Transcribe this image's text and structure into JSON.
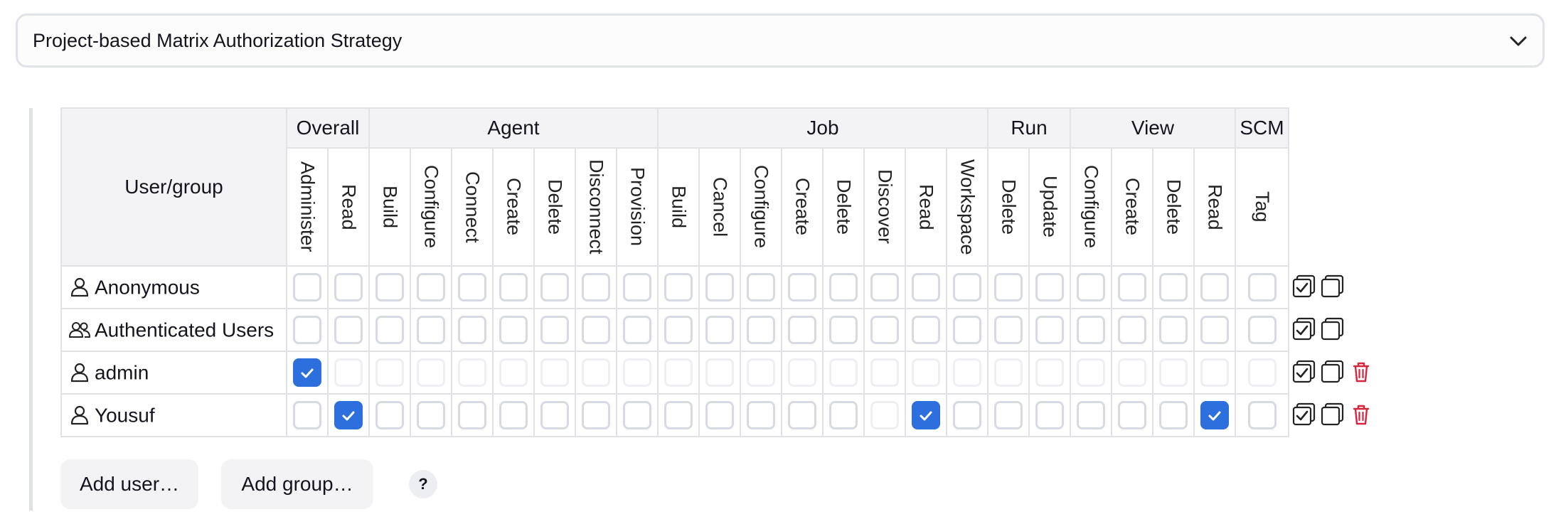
{
  "strategy": {
    "selected": "Project-based Matrix Authorization Strategy"
  },
  "matrix": {
    "user_group_header": "User/group",
    "groups": [
      {
        "label": "Overall",
        "perms": [
          "Administer",
          "Read"
        ]
      },
      {
        "label": "Agent",
        "perms": [
          "Build",
          "Configure",
          "Connect",
          "Create",
          "Delete",
          "Disconnect",
          "Provision"
        ]
      },
      {
        "label": "Job",
        "perms": [
          "Build",
          "Cancel",
          "Configure",
          "Create",
          "Delete",
          "Discover",
          "Read",
          "Workspace"
        ]
      },
      {
        "label": "Run",
        "perms": [
          "Delete",
          "Update"
        ]
      },
      {
        "label": "View",
        "perms": [
          "Configure",
          "Create",
          "Delete",
          "Read"
        ]
      },
      {
        "label": "SCM",
        "perms": [
          "Tag"
        ]
      }
    ],
    "rows": [
      {
        "name": "Anonymous",
        "icon": "user-icon",
        "removable": false,
        "states": [
          "u",
          "u",
          "u",
          "u",
          "u",
          "u",
          "u",
          "u",
          "u",
          "u",
          "u",
          "u",
          "u",
          "u",
          "u",
          "u",
          "u",
          "u",
          "u",
          "u",
          "u",
          "u",
          "u",
          "u"
        ]
      },
      {
        "name": "Authenticated Users",
        "icon": "users-icon",
        "removable": false,
        "states": [
          "u",
          "u",
          "u",
          "u",
          "u",
          "u",
          "u",
          "u",
          "u",
          "u",
          "u",
          "u",
          "u",
          "u",
          "u",
          "u",
          "u",
          "u",
          "u",
          "u",
          "u",
          "u",
          "u",
          "u"
        ]
      },
      {
        "name": "admin",
        "icon": "user-icon",
        "removable": true,
        "states": [
          "c",
          "d",
          "d",
          "d",
          "d",
          "d",
          "d",
          "d",
          "d",
          "d",
          "d",
          "d",
          "d",
          "d",
          "d",
          "d",
          "d",
          "d",
          "d",
          "d",
          "d",
          "d",
          "d",
          "d"
        ]
      },
      {
        "name": "Yousuf",
        "icon": "user-icon",
        "removable": true,
        "states": [
          "u",
          "c",
          "u",
          "u",
          "u",
          "u",
          "u",
          "u",
          "u",
          "u",
          "u",
          "u",
          "u",
          "u",
          "d",
          "c",
          "u",
          "u",
          "u",
          "u",
          "u",
          "u",
          "c",
          "u"
        ]
      }
    ]
  },
  "actions": {
    "add_user": "Add user…",
    "add_group": "Add group…",
    "help": "?"
  },
  "colors": {
    "checked": "#2d6fdc",
    "delete": "#d6263b"
  }
}
